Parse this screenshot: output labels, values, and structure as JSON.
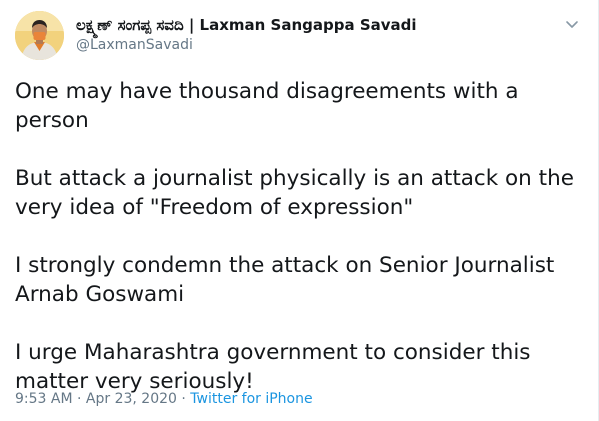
{
  "author": {
    "display_name": "ಲಕ್ಷ್ಮಣ್ ಸಂಗಪ್ಪ ಸವದಿ | Laxman Sangappa Savadi",
    "handle": "@LaxmanSavadi"
  },
  "tweet": {
    "paragraphs": [
      "One may have thousand disagreements with a person",
      "But attack a journalist physically is an attack on  the very idea of \"Freedom of expression\"",
      "I strongly condemn the attack on Senior Journalist Arnab Goswami",
      "I urge Maharashtra government to consider this matter very seriously!"
    ]
  },
  "meta": {
    "time": "9:53 AM",
    "separator": " · ",
    "date": "Apr 23, 2020",
    "source": "Twitter for iPhone"
  },
  "icons": {
    "caret": "chevron-down-icon"
  },
  "colors": {
    "text": "#14171a",
    "secondary": "#657786",
    "link": "#1b95e0",
    "avatar_bg": "#f3d27b"
  }
}
